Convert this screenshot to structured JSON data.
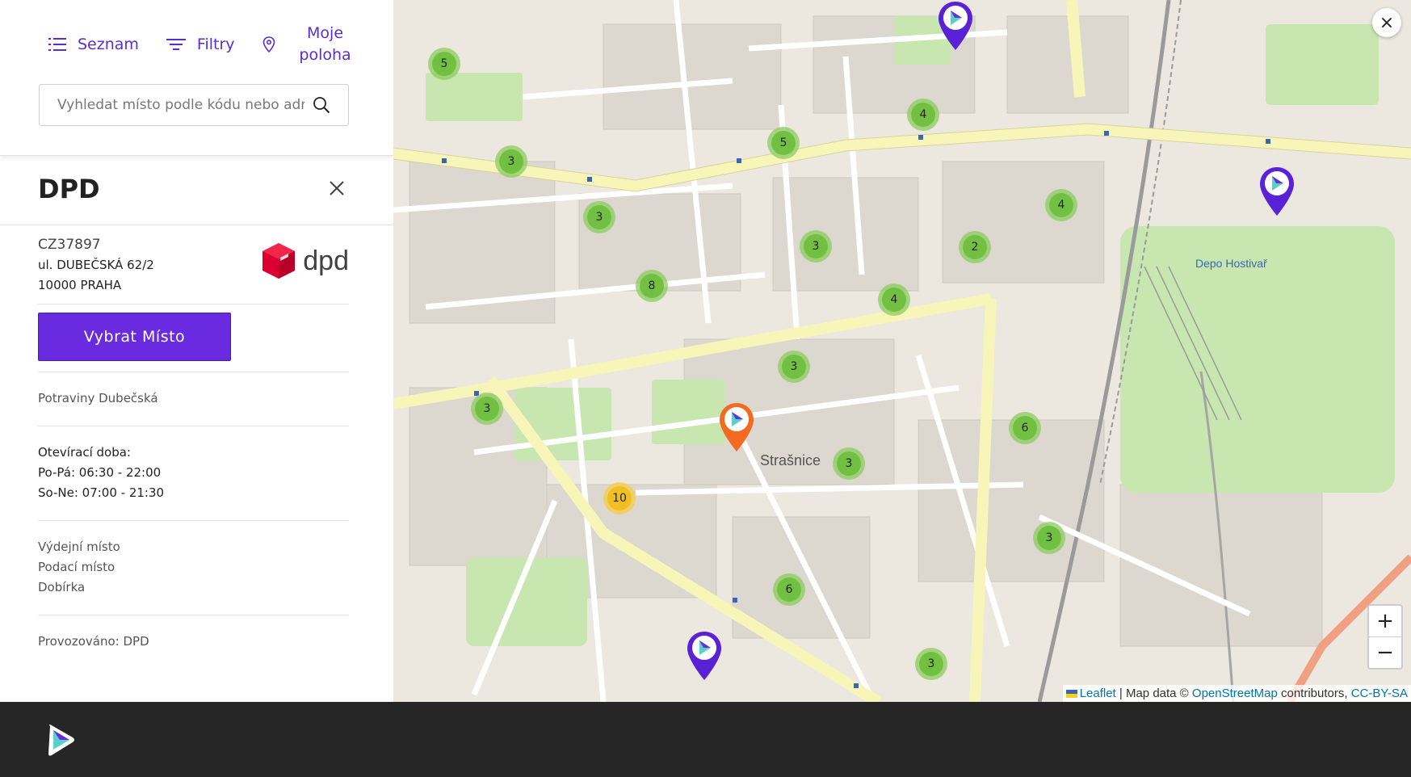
{
  "nav": {
    "list_label": "Seznam",
    "filters_label": "Filtry",
    "location_line1": "Moje",
    "location_line2": "poloha"
  },
  "search": {
    "placeholder": "Vyhledat místo podle kódu nebo adresy"
  },
  "detail": {
    "title": "DPD",
    "code": "CZ37897",
    "street": "ul. DUBEČSKÁ 62/2",
    "city": "10000 PRAHA",
    "logo_text": "dpd",
    "select_button": "Vybrat Místo",
    "place_name": "Potraviny Dubečská",
    "opening_title": "Otevírací doba:",
    "opening_weekdays": "Po-Pá: 06:30 - 22:00",
    "opening_weekend": "So-Ne: 07:00 - 21:30",
    "services": [
      "Výdejní místo",
      "Podací místo",
      "Dobírka"
    ],
    "operated_by": "Provozováno: DPD"
  },
  "map": {
    "close_label": "×",
    "zoom_in": "+",
    "zoom_out": "−",
    "district_label": "Strašnice",
    "depot_label": "Depo Hostivař",
    "clusters": [
      "5",
      "3",
      "3",
      "8",
      "5",
      "4",
      "3",
      "4",
      "2",
      "4",
      "3",
      "3",
      "6",
      "3",
      "10",
      "3",
      "6",
      "3"
    ],
    "attribution": {
      "leaflet": "Leaflet",
      "separator": " | Map data © ",
      "osm": "OpenStreetMap",
      "contributors": " contributors, ",
      "license": "CC-BY-SA"
    },
    "colors": {
      "cluster_green": "#6cbe3c",
      "cluster_yellow": "#f0be1e",
      "pin_purple": "#5a22d6",
      "pin_orange": "#f26b21"
    }
  }
}
